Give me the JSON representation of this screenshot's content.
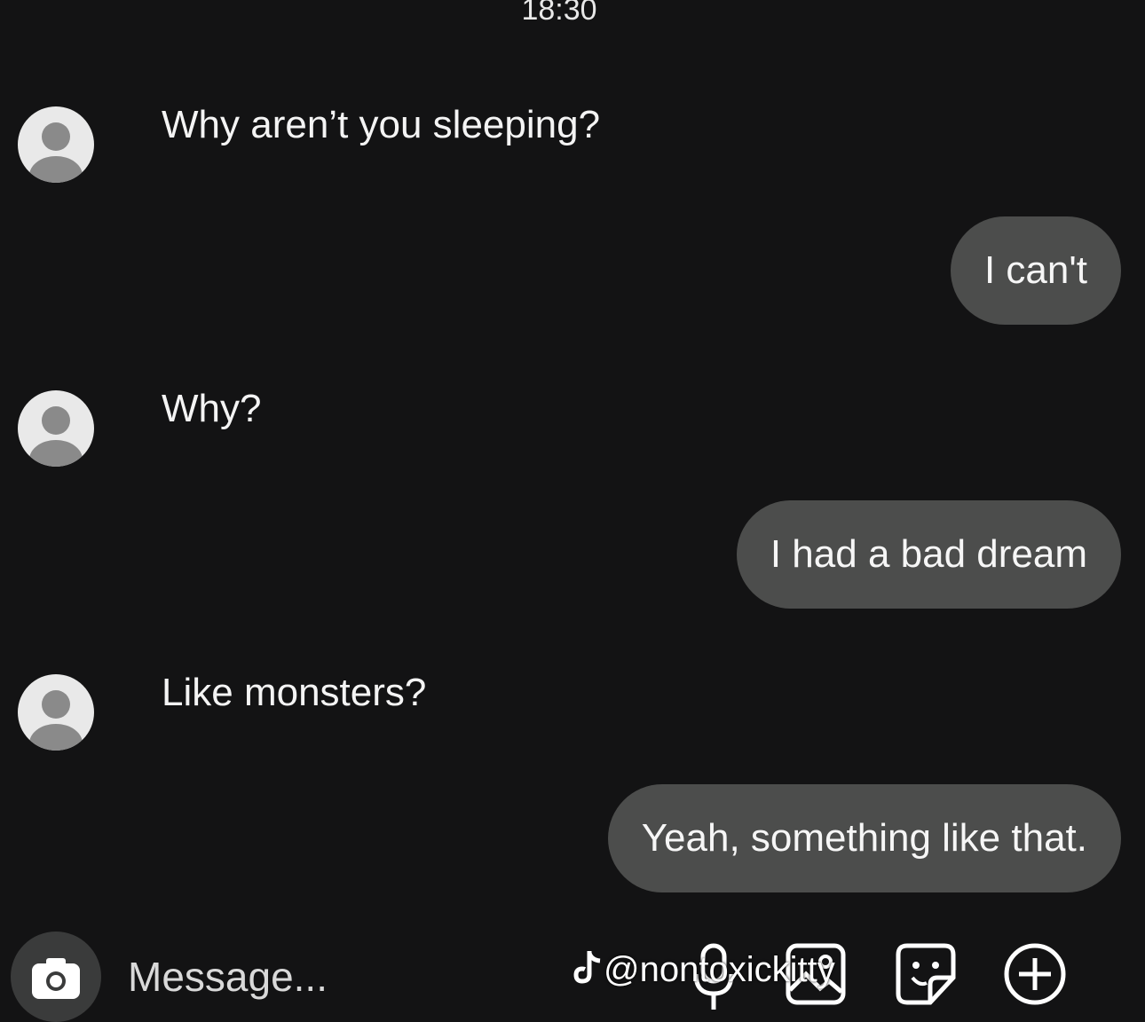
{
  "status_bar": {
    "time": "18:30"
  },
  "messages": [
    {
      "direction": "incoming",
      "text": "Why aren’t you sleeping?"
    },
    {
      "direction": "outgoing",
      "text": "I can't"
    },
    {
      "direction": "incoming",
      "text": "Why?"
    },
    {
      "direction": "outgoing",
      "text": "I had a bad dream"
    },
    {
      "direction": "incoming",
      "text": "Like monsters?"
    },
    {
      "direction": "outgoing",
      "text": "Yeah, something like that."
    }
  ],
  "composer": {
    "placeholder": "Message...",
    "icons": [
      "camera-icon",
      "microphone-icon",
      "gallery-icon",
      "sticker-icon",
      "plus-icon"
    ]
  },
  "watermark": {
    "text": "@nontoxickitty",
    "icon": "tiktok-icon"
  },
  "colors": {
    "background": "#131314",
    "outgoing_bubble": "#4c4d4c",
    "avatar": "#e9e9e9"
  }
}
